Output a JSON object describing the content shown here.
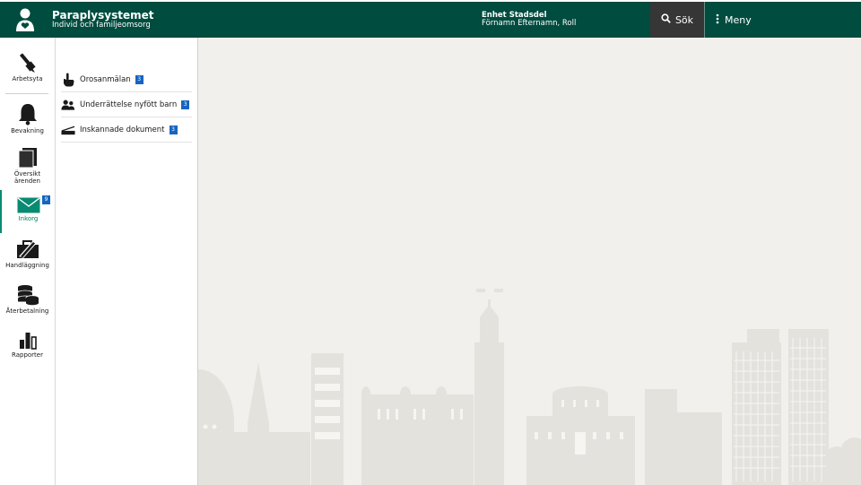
{
  "header": {
    "title": "Paraplysystemet",
    "subtitle": "Individ och familjeomsorg",
    "unit_name": "Enhet Stadsdel",
    "user_line": "Förnamn Efternamn, Roll",
    "search_label": "Sök",
    "menu_label": "Meny"
  },
  "rail": {
    "items": [
      {
        "label": "Arbetsyta",
        "icon": "pen-icon"
      },
      {
        "label": "Bevakning",
        "icon": "bell-icon"
      },
      {
        "label": "Översikt ärenden",
        "icon": "folder-icon"
      },
      {
        "label": "Inkorg",
        "icon": "envelope-icon",
        "badge": "9",
        "active": true
      },
      {
        "label": "Handläggning",
        "icon": "briefcase-icon"
      },
      {
        "label": "Återbetalning",
        "icon": "coins-icon"
      },
      {
        "label": "Rapporter",
        "icon": "bar-chart-icon"
      }
    ]
  },
  "inbox": {
    "items": [
      {
        "label": "Orosanmälan",
        "count": "3",
        "icon": "pointer-hand-icon"
      },
      {
        "label": "Underrättelse nyfött barn",
        "count": "3",
        "icon": "people-icon"
      },
      {
        "label": "Inskannade dokument",
        "count": "3",
        "icon": "scanner-icon"
      }
    ]
  },
  "colors": {
    "header_bg": "#004c3f",
    "search_bg": "#363636",
    "badge": "#1565c0",
    "active": "#0a8a72",
    "main_bg": "#f1f0ec",
    "skyline": "#e3e1dc"
  }
}
